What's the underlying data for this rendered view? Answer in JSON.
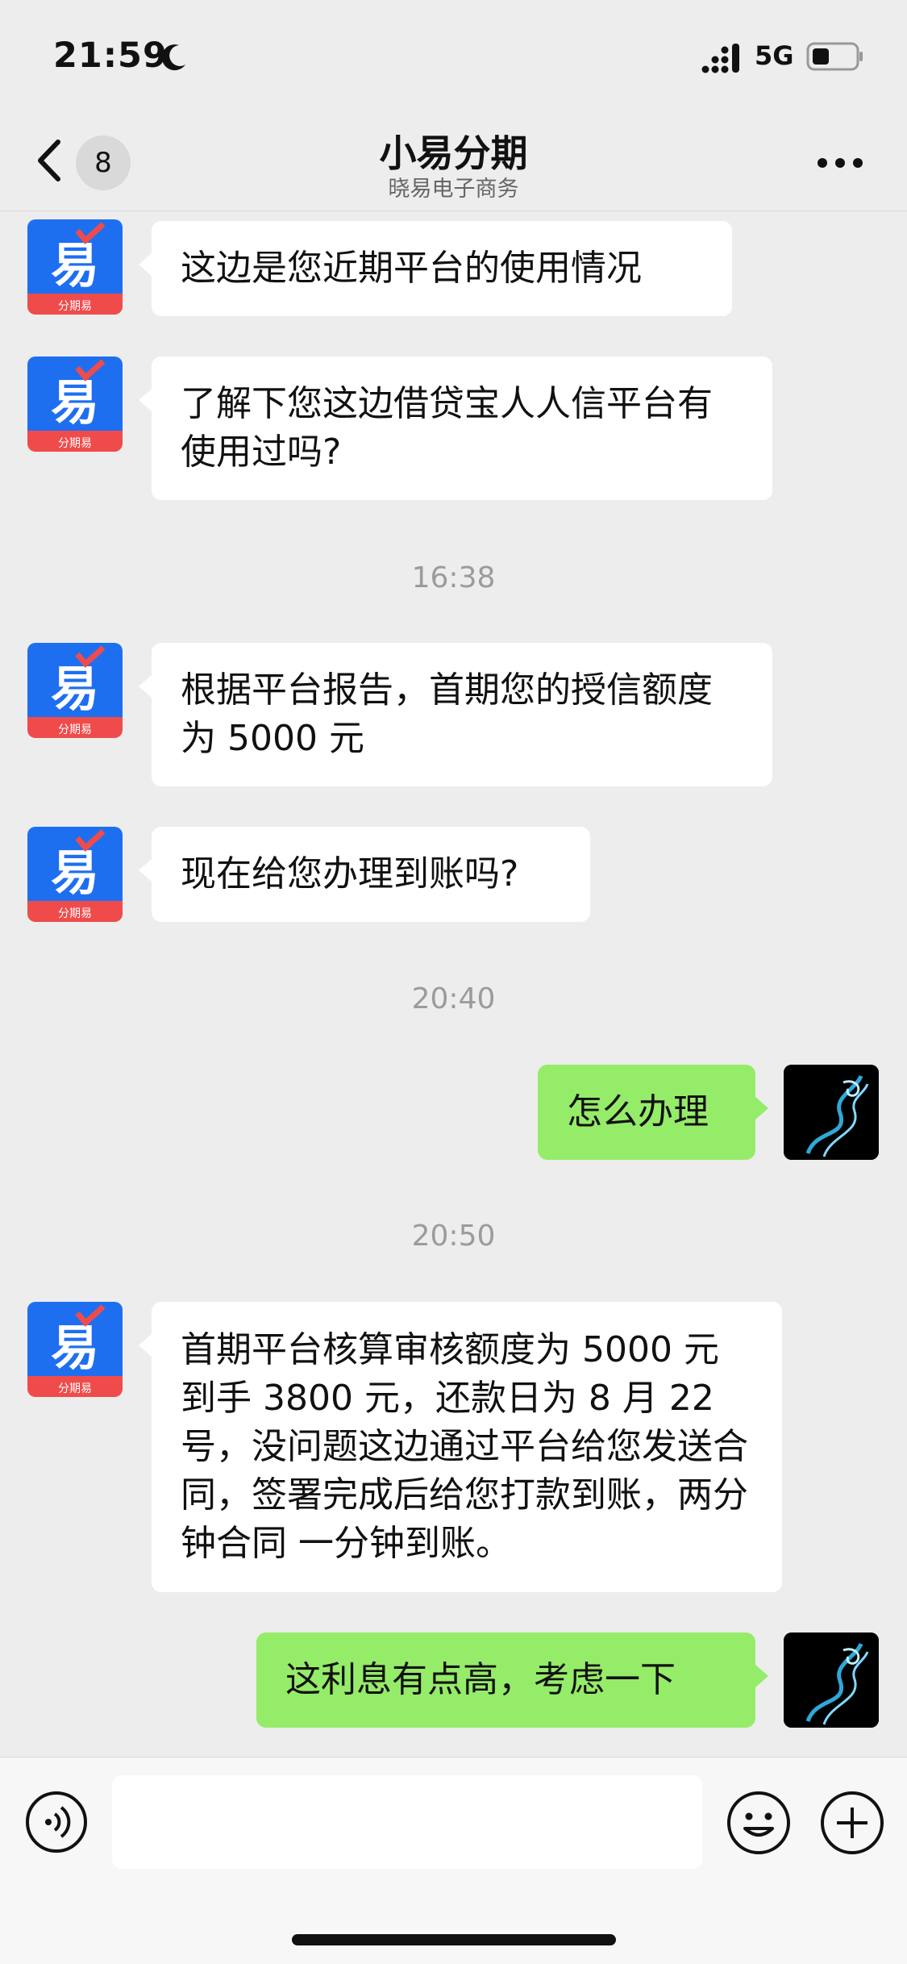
{
  "status_bar": {
    "time": "21:59",
    "network": "5G"
  },
  "nav": {
    "unread_count": "8",
    "title": "小易分期",
    "subtitle": "晓易电子商务"
  },
  "bot_avatar_label": "分期易",
  "messages": [
    {
      "text": "这边是您近期平台的使用情况"
    },
    {
      "text": "了解下您这边借贷宝人人信平台有使用过吗?"
    },
    {
      "text": "根据平台报告，首期您的授信额度为 5000 元"
    },
    {
      "text": "现在给您办理到账吗?"
    },
    {
      "text": "怎么办理"
    },
    {
      "text": "首期平台核算审核额度为 5000 元到手 3800 元，还款日为 8 月 22 号，没问题这边通过平台给您发送合同，签署完成后给您打款到账，两分钟合同 一分钟到账。"
    },
    {
      "text": "这利息有点高，考虑一下"
    }
  ],
  "timestamps": [
    "16:38",
    "20:40",
    "20:50"
  ],
  "colors": {
    "self_bubble": "#95ec69",
    "other_bubble": "#ffffff",
    "background": "#ededed",
    "brand_blue": "#1e6ff0",
    "brand_red": "#f04b4b"
  },
  "icons": [
    "moon-icon",
    "signal-icon",
    "battery-icon",
    "back-chevron-icon",
    "more-icon",
    "voice-icon",
    "emoji-icon",
    "add-icon"
  ]
}
